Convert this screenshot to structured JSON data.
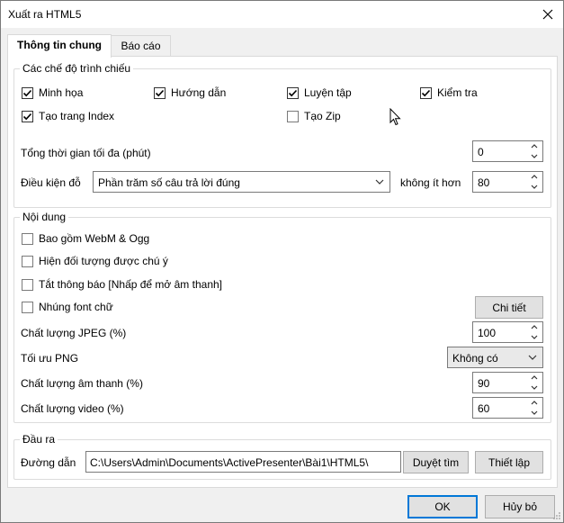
{
  "window": {
    "title": "Xuất ra HTML5"
  },
  "tabs": [
    {
      "label": "Thông tin chung",
      "active": true
    },
    {
      "label": "Báo cáo",
      "active": false
    }
  ],
  "modes": {
    "title": "Các chế độ trình chiếu",
    "items": [
      {
        "label": "Minh họa",
        "checked": true
      },
      {
        "label": "Hướng dẫn",
        "checked": true
      },
      {
        "label": "Luyện tập",
        "checked": true
      },
      {
        "label": "Kiểm tra",
        "checked": true
      },
      {
        "label": "Tạo trang Index",
        "checked": true
      },
      {
        "label": "Tạo Zip",
        "checked": false
      }
    ],
    "max_time": {
      "label": "Tổng thời gian tối đa (phút)",
      "value": "0"
    },
    "pass_condition": {
      "label": "Điều kiện đỗ",
      "selected": "Phần trăm số câu trả lời đúng",
      "not_less_label": "không ít hơn",
      "value": "80"
    }
  },
  "content": {
    "title": "Nội dung",
    "options": [
      {
        "label": "Bao gồm WebM & Ogg",
        "checked": false
      },
      {
        "label": "Hiện đối tượng được chú ý",
        "checked": false
      },
      {
        "label": "Tắt thông báo [Nhấp để mở âm thanh]",
        "checked": false
      },
      {
        "label": "Nhúng font chữ",
        "checked": false
      }
    ],
    "details_button": "Chi tiết",
    "jpeg_quality": {
      "label": "Chất lượng JPEG (%)",
      "value": "100"
    },
    "png_optimize": {
      "label": "Tối ưu PNG",
      "selected": "Không có"
    },
    "audio_quality": {
      "label": "Chất lượng âm thanh (%)",
      "value": "90"
    },
    "video_quality": {
      "label": "Chất lượng video (%)",
      "value": "60"
    }
  },
  "output": {
    "title": "Đầu ra",
    "path_label": "Đường dẫn",
    "path_value": "C:\\Users\\Admin\\Documents\\ActivePresenter\\Bài1\\HTML5\\",
    "browse_button": "Duyệt tìm",
    "settings_button": "Thiết lập"
  },
  "footer": {
    "ok": "OK",
    "cancel": "Hủy bỏ"
  },
  "icons": {
    "close": "close-icon",
    "check": "check-icon",
    "chevron": "chevron-down-icon",
    "spin_up": "spin-up-icon",
    "spin_down": "spin-down-icon",
    "cursor": "mouse-cursor-icon"
  }
}
